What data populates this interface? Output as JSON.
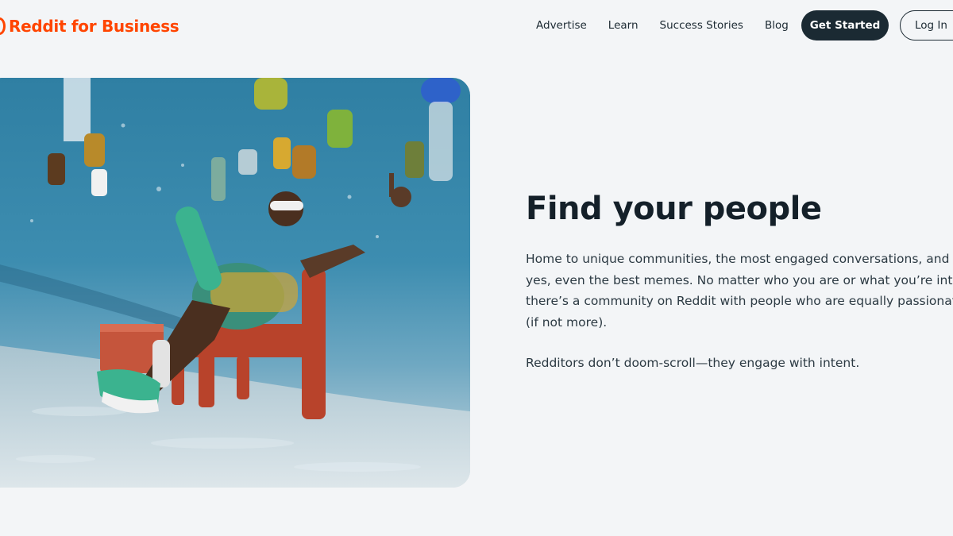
{
  "header": {
    "brand": "Reddit for Business",
    "nav": [
      "Advertise",
      "Learn",
      "Success Stories",
      "Blog"
    ],
    "get_started": "Get Started",
    "log_in": "Log In"
  },
  "hero": {
    "heading": "Find your people",
    "paragraph1": "Home to unique communities, the most engaged conversations, and yes, even the best memes. No matter who you are or what you’re into, there’s a community on Reddit with people who are equally passionate (if not more).",
    "paragraph2": "Redditors don’t doom-scroll—they engage with intent."
  },
  "colors": {
    "brand": "#ff4500",
    "primary_button": "#1b2a33",
    "background": "#f3f5f7"
  }
}
